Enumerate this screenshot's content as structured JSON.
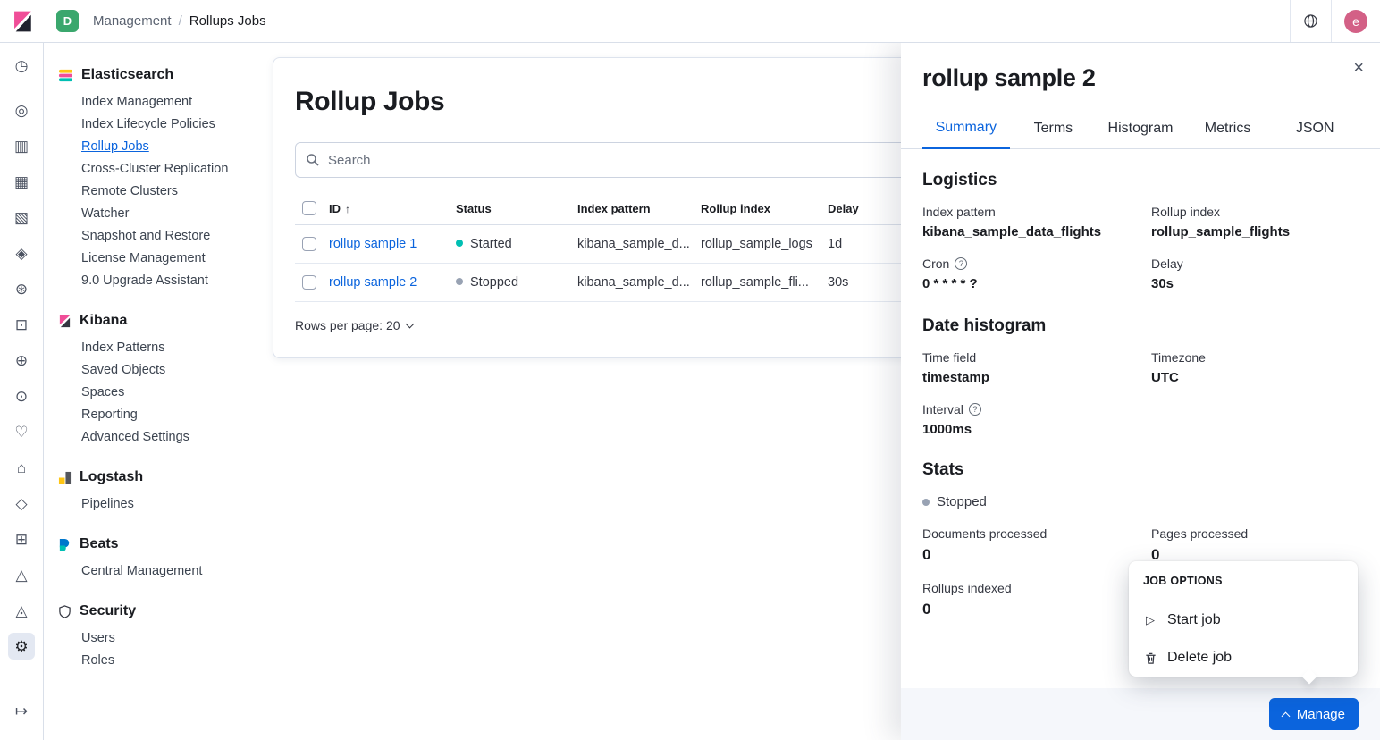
{
  "topbar": {
    "space_badge": "D",
    "breadcrumb": [
      "Management",
      "Rollups Jobs"
    ],
    "separator": "/",
    "avatar": "e"
  },
  "rail": {
    "icons": [
      {
        "name": "recently-viewed",
        "glyph": "◷"
      },
      {
        "name": "discover",
        "glyph": "◎"
      },
      {
        "name": "visualize",
        "glyph": "▥"
      },
      {
        "name": "dashboard",
        "glyph": "▦"
      },
      {
        "name": "canvas",
        "glyph": "▧"
      },
      {
        "name": "maps",
        "glyph": "◈"
      },
      {
        "name": "machine-learning",
        "glyph": "⊛"
      },
      {
        "name": "graph",
        "glyph": "⊡"
      },
      {
        "name": "logs",
        "glyph": "⊕"
      },
      {
        "name": "metrics",
        "glyph": "⊙"
      },
      {
        "name": "apm",
        "glyph": "♡"
      },
      {
        "name": "uptime",
        "glyph": "⌂"
      },
      {
        "name": "siem",
        "glyph": "◇"
      },
      {
        "name": "dev-tools",
        "glyph": "⊞"
      },
      {
        "name": "stack-monitoring",
        "glyph": "△"
      },
      {
        "name": "watcher",
        "glyph": "◬"
      },
      {
        "name": "management",
        "glyph": "⚙"
      }
    ],
    "collapse_glyph": "↦"
  },
  "sidebar": {
    "sections": [
      {
        "title": "Elasticsearch",
        "items": [
          "Index Management",
          "Index Lifecycle Policies",
          "Rollup Jobs",
          "Cross-Cluster Replication",
          "Remote Clusters",
          "Watcher",
          "Snapshot and Restore",
          "License Management",
          "9.0 Upgrade Assistant"
        ]
      },
      {
        "title": "Kibana",
        "items": [
          "Index Patterns",
          "Saved Objects",
          "Spaces",
          "Reporting",
          "Advanced Settings"
        ]
      },
      {
        "title": "Logstash",
        "items": [
          "Pipelines"
        ]
      },
      {
        "title": "Beats",
        "items": [
          "Central Management"
        ]
      },
      {
        "title": "Security",
        "items": [
          "Users",
          "Roles"
        ]
      }
    ],
    "active_item": "Rollup Jobs"
  },
  "main": {
    "title": "Rollup Jobs",
    "search_placeholder": "Search",
    "table": {
      "columns": [
        "ID",
        "Status",
        "Index pattern",
        "Rollup index",
        "Delay"
      ],
      "rows": [
        {
          "id": "rollup sample 1",
          "status": "Started",
          "index_pattern": "kibana_sample_d...",
          "rollup_index": "rollup_sample_logs",
          "delay": "1d"
        },
        {
          "id": "rollup sample 2",
          "status": "Stopped",
          "index_pattern": "kibana_sample_d...",
          "rollup_index": "rollup_sample_fli...",
          "delay": "30s"
        }
      ]
    },
    "rows_per_page": "Rows per page: 20"
  },
  "flyout": {
    "title": "rollup sample 2",
    "tabs": [
      "Summary",
      "Terms",
      "Histogram",
      "Metrics",
      "JSON"
    ],
    "active_tab": "Summary",
    "logistics": {
      "title": "Logistics",
      "index_pattern_label": "Index pattern",
      "index_pattern": "kibana_sample_data_flights",
      "rollup_index_label": "Rollup index",
      "rollup_index": "rollup_sample_flights",
      "cron_label": "Cron",
      "cron": "0 * * * * ?",
      "delay_label": "Delay",
      "delay": "30s"
    },
    "date_histogram": {
      "title": "Date histogram",
      "time_field_label": "Time field",
      "time_field": "timestamp",
      "timezone_label": "Timezone",
      "timezone": "UTC",
      "interval_label": "Interval",
      "interval": "1000ms"
    },
    "stats": {
      "title": "Stats",
      "status": "Stopped",
      "documents_processed_label": "Documents processed",
      "documents_processed": "0",
      "pages_processed_label": "Pages processed",
      "pages_processed": "0",
      "rollups_indexed_label": "Rollups indexed",
      "rollups_indexed": "0"
    },
    "manage_button": "Manage"
  },
  "popover": {
    "title": "JOB OPTIONS",
    "items": [
      "Start job",
      "Delete job"
    ]
  },
  "icons": {
    "question": "?",
    "play": "▷",
    "sort_asc": "↑"
  },
  "colors": {
    "accent": "#0b64dd",
    "status_started": "#00bfb3",
    "status_stopped": "#98a2b3",
    "space_badge_green": "#3aa76d",
    "avatar_pink": "#d36086",
    "brand_pink": "#f04e98"
  }
}
